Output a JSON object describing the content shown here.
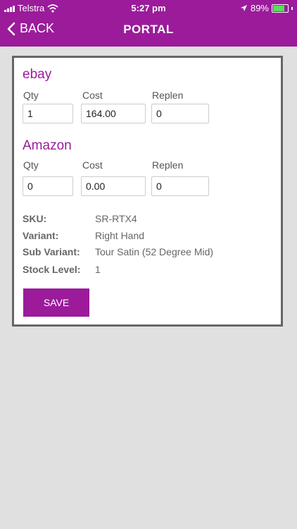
{
  "status": {
    "carrier": "Telstra",
    "time": "5:27 pm",
    "battery": "89%",
    "battery_level": 0.89
  },
  "nav": {
    "back_label": "BACK",
    "title": "PORTAL"
  },
  "ebay": {
    "title": "ebay",
    "labels": {
      "qty": "Qty",
      "cost": "Cost",
      "replen": "Replen"
    },
    "values": {
      "qty": "1",
      "cost": "164.00",
      "replen": "0"
    }
  },
  "amazon": {
    "title": "Amazon",
    "labels": {
      "qty": "Qty",
      "cost": "Cost",
      "replen": "Replen"
    },
    "values": {
      "qty": "0",
      "cost": "0.00",
      "replen": "0"
    }
  },
  "product": {
    "sku_label": "SKU:",
    "sku": "SR-RTX4",
    "variant_label": "Variant:",
    "variant": "Right Hand",
    "sub_variant_label": "Sub Variant:",
    "sub_variant": "Tour Satin (52 Degree Mid)",
    "stock_label": "Stock Level:",
    "stock": "1"
  },
  "actions": {
    "save_label": "SAVE"
  },
  "colors": {
    "brand": "#9b1b9b",
    "background": "#e0e0e0"
  }
}
